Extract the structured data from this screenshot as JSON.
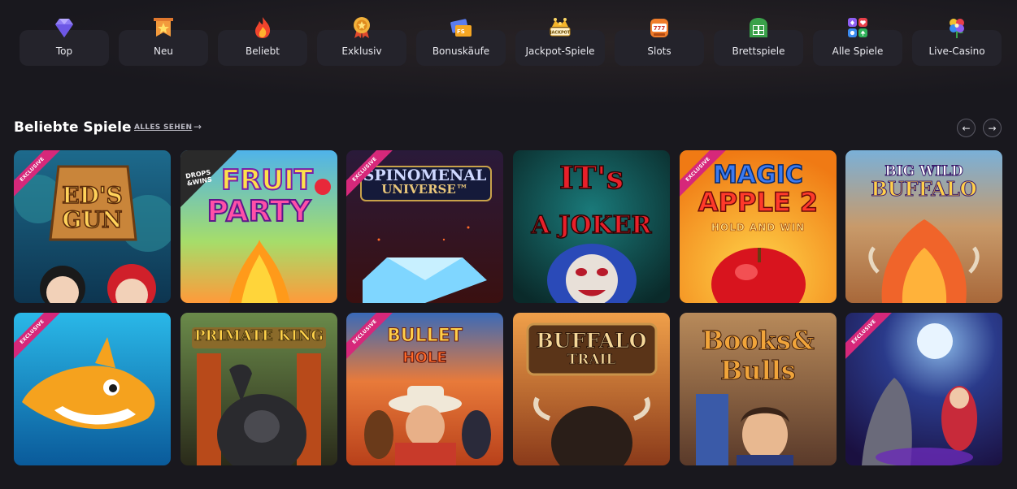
{
  "categories": [
    {
      "label": "Top",
      "icon": "diamond-icon"
    },
    {
      "label": "Neu",
      "icon": "star-banner-icon"
    },
    {
      "label": "Beliebt",
      "icon": "fire-icon"
    },
    {
      "label": "Exklusiv",
      "icon": "medal-icon"
    },
    {
      "label": "Bonuskäufe",
      "icon": "free-spins-ticket-icon"
    },
    {
      "label": "Jackpot-Spiele",
      "icon": "jackpot-crown-icon",
      "badge": "JACKPOT"
    },
    {
      "label": "Slots",
      "icon": "slot-machine-icon",
      "badge": "777"
    },
    {
      "label": "Brettspiele",
      "icon": "board-game-icon"
    },
    {
      "label": "Alle Spiele",
      "icon": "card-suits-icon"
    },
    {
      "label": "Live-Casino",
      "icon": "clover-flower-icon"
    }
  ],
  "section": {
    "title": "Beliebte Spiele",
    "see_all": "ALLES SEHEN",
    "see_all_arrow": "→",
    "prev": "←",
    "next": "→"
  },
  "games": [
    {
      "title_lines": [
        "ED'S",
        "GUN"
      ],
      "exclusive": "EXCLUSIVE"
    },
    {
      "title_lines": [
        "FRUIT",
        "PARTY"
      ],
      "badge_lines": [
        "DROPS",
        "&WINS"
      ]
    },
    {
      "title_lines": [
        "SPINOMENAL",
        "UNIVERSE™"
      ],
      "exclusive": "EXCLUSIVE"
    },
    {
      "title_lines": [
        "IT's",
        "A JOKER"
      ]
    },
    {
      "title_lines": [
        "MAGIC",
        "APPLE 2",
        "HOLD AND WIN"
      ],
      "exclusive": "EXCLUSIVE"
    },
    {
      "title_lines": [
        "BIG WILD",
        "BUFFALO"
      ]
    },
    {
      "title_lines": [],
      "exclusive": "EXCLUSIVE"
    },
    {
      "title_lines": [
        "PRIMATE KING"
      ]
    },
    {
      "title_lines": [
        "BULLET",
        "HOLE"
      ],
      "exclusive": "EXCLUSIVE"
    },
    {
      "title_lines": [
        "BUFFALO",
        "TRAIL"
      ]
    },
    {
      "title_lines": [
        "Books&",
        "Bulls"
      ]
    },
    {
      "title_lines": [],
      "exclusive": "EXCLUSIVE"
    }
  ],
  "colors": {
    "background": "#19181e",
    "category_bg": "#24232b",
    "exclusive_ribbon": "#d6287a"
  }
}
